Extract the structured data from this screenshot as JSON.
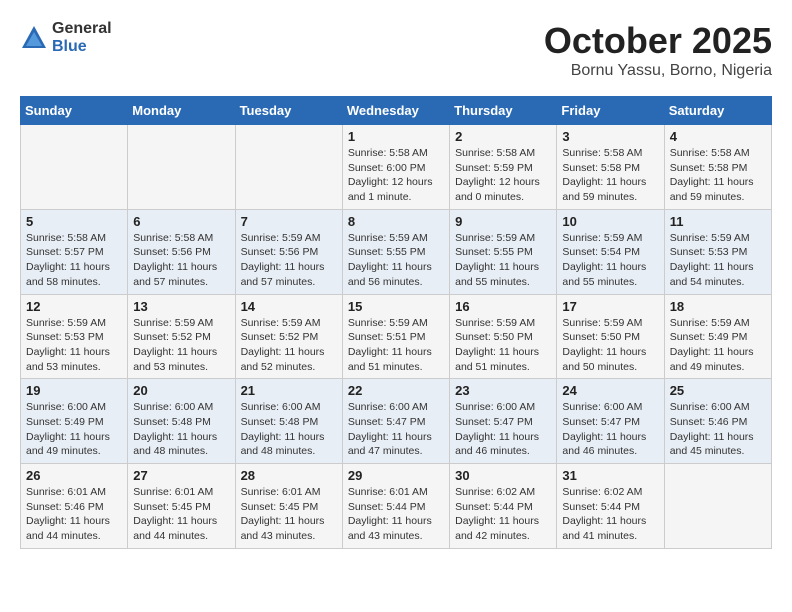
{
  "header": {
    "logo": {
      "general": "General",
      "blue": "Blue"
    },
    "month": "October 2025",
    "location": "Bornu Yassu, Borno, Nigeria"
  },
  "days_of_week": [
    "Sunday",
    "Monday",
    "Tuesday",
    "Wednesday",
    "Thursday",
    "Friday",
    "Saturday"
  ],
  "weeks": [
    [
      {
        "day": "",
        "info": ""
      },
      {
        "day": "",
        "info": ""
      },
      {
        "day": "",
        "info": ""
      },
      {
        "day": "1",
        "info": "Sunrise: 5:58 AM\nSunset: 6:00 PM\nDaylight: 12 hours\nand 1 minute."
      },
      {
        "day": "2",
        "info": "Sunrise: 5:58 AM\nSunset: 5:59 PM\nDaylight: 12 hours\nand 0 minutes."
      },
      {
        "day": "3",
        "info": "Sunrise: 5:58 AM\nSunset: 5:58 PM\nDaylight: 11 hours\nand 59 minutes."
      },
      {
        "day": "4",
        "info": "Sunrise: 5:58 AM\nSunset: 5:58 PM\nDaylight: 11 hours\nand 59 minutes."
      }
    ],
    [
      {
        "day": "5",
        "info": "Sunrise: 5:58 AM\nSunset: 5:57 PM\nDaylight: 11 hours\nand 58 minutes."
      },
      {
        "day": "6",
        "info": "Sunrise: 5:58 AM\nSunset: 5:56 PM\nDaylight: 11 hours\nand 57 minutes."
      },
      {
        "day": "7",
        "info": "Sunrise: 5:59 AM\nSunset: 5:56 PM\nDaylight: 11 hours\nand 57 minutes."
      },
      {
        "day": "8",
        "info": "Sunrise: 5:59 AM\nSunset: 5:55 PM\nDaylight: 11 hours\nand 56 minutes."
      },
      {
        "day": "9",
        "info": "Sunrise: 5:59 AM\nSunset: 5:55 PM\nDaylight: 11 hours\nand 55 minutes."
      },
      {
        "day": "10",
        "info": "Sunrise: 5:59 AM\nSunset: 5:54 PM\nDaylight: 11 hours\nand 55 minutes."
      },
      {
        "day": "11",
        "info": "Sunrise: 5:59 AM\nSunset: 5:53 PM\nDaylight: 11 hours\nand 54 minutes."
      }
    ],
    [
      {
        "day": "12",
        "info": "Sunrise: 5:59 AM\nSunset: 5:53 PM\nDaylight: 11 hours\nand 53 minutes."
      },
      {
        "day": "13",
        "info": "Sunrise: 5:59 AM\nSunset: 5:52 PM\nDaylight: 11 hours\nand 53 minutes."
      },
      {
        "day": "14",
        "info": "Sunrise: 5:59 AM\nSunset: 5:52 PM\nDaylight: 11 hours\nand 52 minutes."
      },
      {
        "day": "15",
        "info": "Sunrise: 5:59 AM\nSunset: 5:51 PM\nDaylight: 11 hours\nand 51 minutes."
      },
      {
        "day": "16",
        "info": "Sunrise: 5:59 AM\nSunset: 5:50 PM\nDaylight: 11 hours\nand 51 minutes."
      },
      {
        "day": "17",
        "info": "Sunrise: 5:59 AM\nSunset: 5:50 PM\nDaylight: 11 hours\nand 50 minutes."
      },
      {
        "day": "18",
        "info": "Sunrise: 5:59 AM\nSunset: 5:49 PM\nDaylight: 11 hours\nand 49 minutes."
      }
    ],
    [
      {
        "day": "19",
        "info": "Sunrise: 6:00 AM\nSunset: 5:49 PM\nDaylight: 11 hours\nand 49 minutes."
      },
      {
        "day": "20",
        "info": "Sunrise: 6:00 AM\nSunset: 5:48 PM\nDaylight: 11 hours\nand 48 minutes."
      },
      {
        "day": "21",
        "info": "Sunrise: 6:00 AM\nSunset: 5:48 PM\nDaylight: 11 hours\nand 48 minutes."
      },
      {
        "day": "22",
        "info": "Sunrise: 6:00 AM\nSunset: 5:47 PM\nDaylight: 11 hours\nand 47 minutes."
      },
      {
        "day": "23",
        "info": "Sunrise: 6:00 AM\nSunset: 5:47 PM\nDaylight: 11 hours\nand 46 minutes."
      },
      {
        "day": "24",
        "info": "Sunrise: 6:00 AM\nSunset: 5:47 PM\nDaylight: 11 hours\nand 46 minutes."
      },
      {
        "day": "25",
        "info": "Sunrise: 6:00 AM\nSunset: 5:46 PM\nDaylight: 11 hours\nand 45 minutes."
      }
    ],
    [
      {
        "day": "26",
        "info": "Sunrise: 6:01 AM\nSunset: 5:46 PM\nDaylight: 11 hours\nand 44 minutes."
      },
      {
        "day": "27",
        "info": "Sunrise: 6:01 AM\nSunset: 5:45 PM\nDaylight: 11 hours\nand 44 minutes."
      },
      {
        "day": "28",
        "info": "Sunrise: 6:01 AM\nSunset: 5:45 PM\nDaylight: 11 hours\nand 43 minutes."
      },
      {
        "day": "29",
        "info": "Sunrise: 6:01 AM\nSunset: 5:44 PM\nDaylight: 11 hours\nand 43 minutes."
      },
      {
        "day": "30",
        "info": "Sunrise: 6:02 AM\nSunset: 5:44 PM\nDaylight: 11 hours\nand 42 minutes."
      },
      {
        "day": "31",
        "info": "Sunrise: 6:02 AM\nSunset: 5:44 PM\nDaylight: 11 hours\nand 41 minutes."
      },
      {
        "day": "",
        "info": ""
      }
    ]
  ]
}
